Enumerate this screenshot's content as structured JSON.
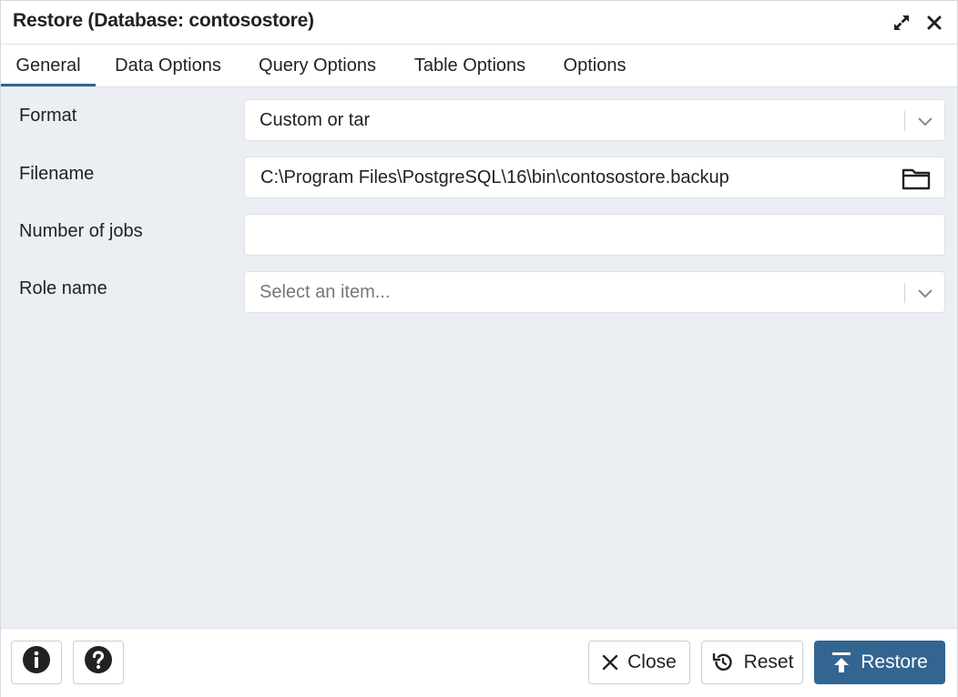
{
  "dialog": {
    "title": "Restore (Database: contosostore)",
    "expand_icon": "expand-icon",
    "close_icon": "close-icon"
  },
  "tabs": [
    {
      "label": "General",
      "active": true
    },
    {
      "label": "Data Options",
      "active": false
    },
    {
      "label": "Query Options",
      "active": false
    },
    {
      "label": "Table Options",
      "active": false
    },
    {
      "label": "Options",
      "active": false
    }
  ],
  "form": {
    "format": {
      "label": "Format",
      "value": "Custom or tar"
    },
    "filename": {
      "label": "Filename",
      "value": "C:\\Program Files\\PostgreSQL\\16\\bin\\contosostore.backup",
      "icon": "folder-icon"
    },
    "jobs": {
      "label": "Number of jobs",
      "value": ""
    },
    "role": {
      "label": "Role name",
      "placeholder": "Select an item..."
    }
  },
  "footer": {
    "info_icon": "info-icon",
    "help_icon": "help-icon",
    "close_label": "Close",
    "reset_label": "Reset",
    "restore_label": "Restore"
  },
  "colors": {
    "accent": "#326690",
    "background": "#ebeef3"
  }
}
